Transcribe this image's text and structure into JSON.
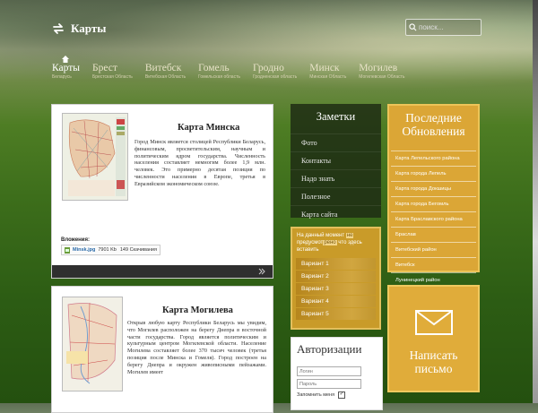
{
  "header": {
    "site_title": "Карты",
    "search_placeholder": "поиск..."
  },
  "nav": [
    {
      "label": "Карты",
      "sub": "Беларусь",
      "active": true
    },
    {
      "label": "Брест",
      "sub": "Брестская Область",
      "active": false
    },
    {
      "label": "Витебск",
      "sub": "Витебская Область",
      "active": false
    },
    {
      "label": "Гомель",
      "sub": "Гомельская область",
      "active": false
    },
    {
      "label": "Гродно",
      "sub": "Гродненская область",
      "active": false
    },
    {
      "label": "Минск",
      "sub": "Минская Область",
      "active": false
    },
    {
      "label": "Могилев",
      "sub": "Могилевская Область",
      "active": false
    }
  ],
  "article1": {
    "title": "Карта Минска",
    "text": "Город Минск является столицей Республики Беларусь, финансовым, просветительским, научным и политическим ядром государства. Численность населения составляет немногим более 1,9 млн. человек. Это примерно десятая позиция по численности населения в Европе, третья в Евразийском экономическом союзе.",
    "downloads_label": "Вложения:",
    "file_name": "Minsk.jpg",
    "file_size": "7901 Kb",
    "downloads_count": "149 Скачивания"
  },
  "article2": {
    "title": "Карта Могилева",
    "text": "Открыв любую карту Республики Беларусь мы увидим, что Могилев расположен на берегу Днепра в восточной части государства. Город является политическим и культурным центром Могилевской области. Население Могилева составляет более 370 тысяч человек (третья позиция после Минска и Гомеля). Город построен на берегу Днепра и окружен живописными пейзажами. Могилев имеет"
  },
  "notes": {
    "title": "Заметки",
    "items": [
      "Фото",
      "Контакты",
      "Надо знать",
      "Полезное",
      "Карта сайта"
    ]
  },
  "variants": {
    "message_a": "На данный момент ",
    "message_hl1": "не",
    "message_b": " предусмот",
    "message_hl2": "рено",
    "message_c": " что здесь вставить",
    "items": [
      "Вариант 1",
      "Вариант 2",
      "Вариант 3",
      "Вариант 4",
      "Вариант 5"
    ]
  },
  "latest": {
    "title": "Последние Обновления",
    "items": [
      "Карта Лепельского района",
      "Карта города Лепель",
      "Карта города Докшицы",
      "Карта города Бегомль",
      "Карта Браславского района",
      "Браслав",
      "Витебский район",
      "Витебск",
      "Лунинецкий район"
    ]
  },
  "write": {
    "label": "Написать письмо"
  },
  "auth": {
    "title": "Авторизации",
    "login_placeholder": "Логин",
    "password_placeholder": "Пароль",
    "remember_label": "Запомнить меня"
  },
  "colors": {
    "accent_gold": "#dba636",
    "notes_bg": "#1e2d14",
    "footer_dark": "#2f2f2f"
  }
}
